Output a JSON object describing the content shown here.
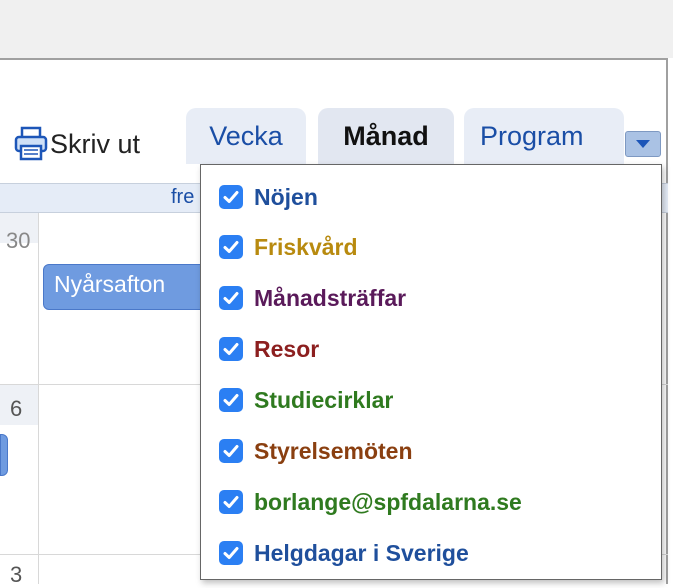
{
  "toolbar": {
    "print_label": "Skriv ut",
    "tabs": [
      {
        "label": "Vecka"
      },
      {
        "label": "Månad"
      },
      {
        "label": "Program"
      }
    ]
  },
  "calendar": {
    "header_fragment": "fre",
    "day_numbers": [
      "30",
      "6",
      "3"
    ],
    "event_label": "Nyårsafton"
  },
  "dropdown": {
    "items": [
      {
        "label": "Nöjen",
        "checked": true,
        "color": "#1f4f9c"
      },
      {
        "label": "Friskvård",
        "checked": true,
        "color": "#b88a0f"
      },
      {
        "label": "Månadsträffar",
        "checked": true,
        "color": "#5a1a5a"
      },
      {
        "label": "Resor",
        "checked": true,
        "color": "#8c1f1f"
      },
      {
        "label": "Studiecirklar",
        "checked": true,
        "color": "#2f7a1f"
      },
      {
        "label": "Styrelsemöten",
        "checked": true,
        "color": "#8a3f10"
      },
      {
        "label": "borlange@spfdalarna.se",
        "checked": true,
        "color": "#2f7a1f"
      },
      {
        "label": "Helgdagar i Sverige",
        "checked": true,
        "color": "#1f4f9c"
      }
    ]
  },
  "colors": {
    "checkbox": "#2b7ff3",
    "event": "#6f9be0",
    "tab_active_text": "#111111",
    "tab_text": "#1a4ea6"
  }
}
